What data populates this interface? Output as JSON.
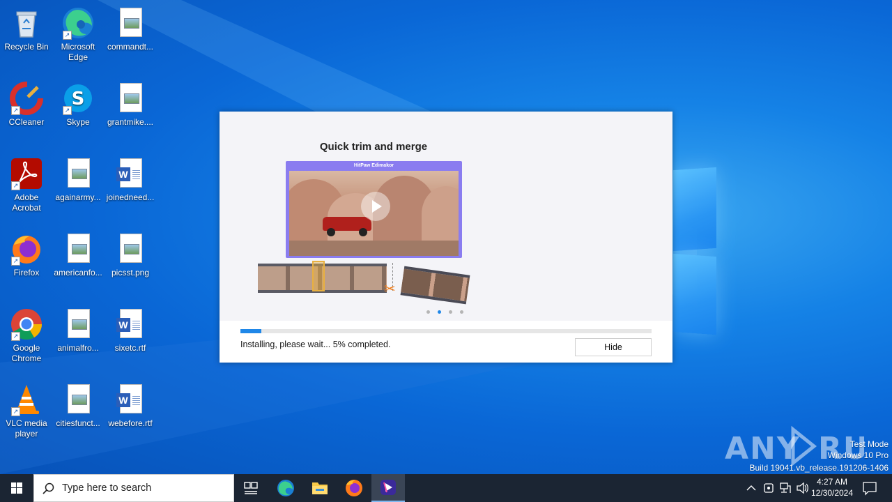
{
  "desktop": {
    "icons": [
      {
        "label": "Recycle Bin",
        "icon": "recycle-bin-icon"
      },
      {
        "label": "Microsoft Edge",
        "icon": "edge-icon"
      },
      {
        "label": "commandt...",
        "icon": "image-file-icon"
      },
      {
        "label": "CCleaner",
        "icon": "ccleaner-icon"
      },
      {
        "label": "Skype",
        "icon": "skype-icon"
      },
      {
        "label": "grantmike....",
        "icon": "image-file-icon"
      },
      {
        "label": "Adobe Acrobat",
        "icon": "acrobat-icon"
      },
      {
        "label": "againarmy...",
        "icon": "image-file-icon"
      },
      {
        "label": "joinedneed...",
        "icon": "word-file-icon"
      },
      {
        "label": "Firefox",
        "icon": "firefox-icon"
      },
      {
        "label": "americanfo...",
        "icon": "image-file-icon"
      },
      {
        "label": "picsst.png",
        "icon": "image-file-icon"
      },
      {
        "label": "Google Chrome",
        "icon": "chrome-icon"
      },
      {
        "label": "animalfro...",
        "icon": "image-file-icon"
      },
      {
        "label": "sixetc.rtf",
        "icon": "word-file-icon"
      },
      {
        "label": "VLC media player",
        "icon": "vlc-icon"
      },
      {
        "label": "citiesfunct...",
        "icon": "image-file-icon"
      },
      {
        "label": "webefore.rtf",
        "icon": "word-file-icon"
      }
    ]
  },
  "installer": {
    "slide_title": "Quick trim and merge",
    "preview_app_name": "HitPaw Edimakor",
    "slides_count": 4,
    "active_slide": 2,
    "progress_percent": 5,
    "status_text": "Installing, please wait... 5% completed.",
    "hide_label": "Hide",
    "colors": {
      "accent": "#1f87e8",
      "preview_frame": "#8a7cf0"
    }
  },
  "watermark": {
    "logo_text": "ANY RUN",
    "mode": "Test Mode",
    "edition": "Windows 10 Pro",
    "build": "Build 19041.vb_release.191206-1406"
  },
  "taskbar": {
    "search_placeholder": "Type here to search",
    "apps": [
      "task-view-icon",
      "edge-icon",
      "file-explorer-icon",
      "firefox-icon",
      "edimakor-icon"
    ],
    "time": "4:27 AM",
    "date": "12/30/2024"
  }
}
